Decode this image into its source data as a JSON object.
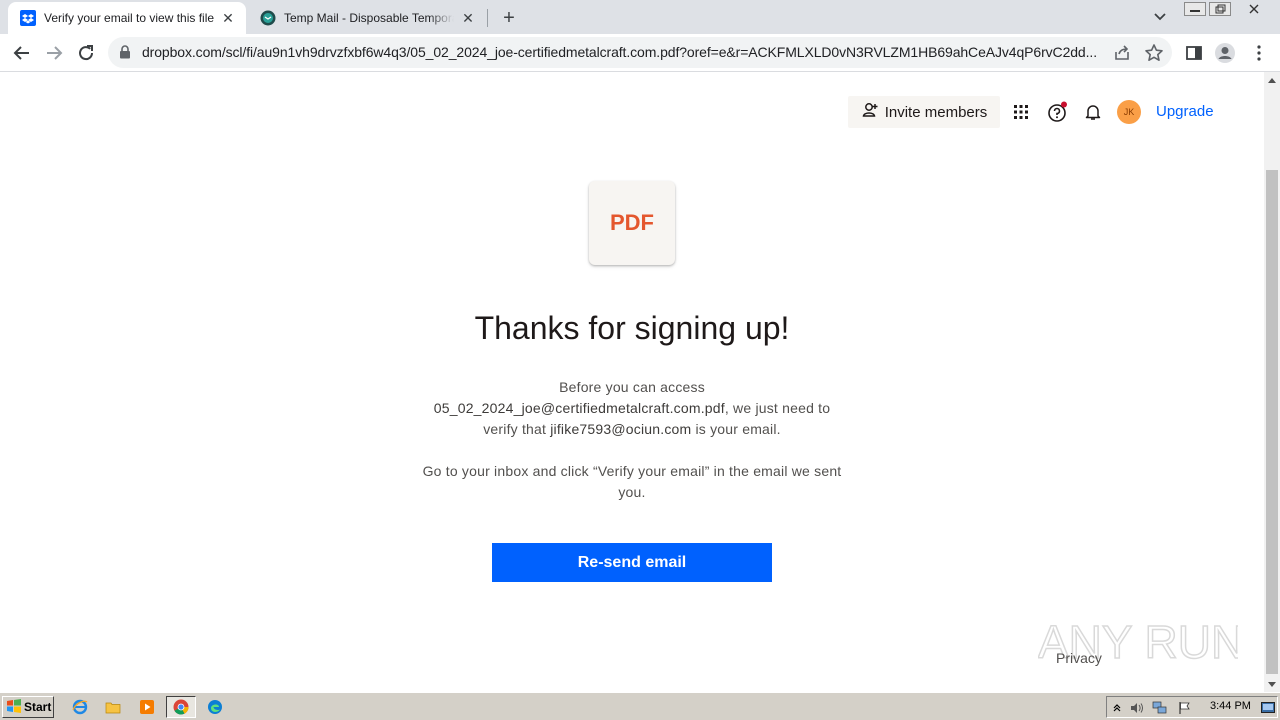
{
  "browser": {
    "tabs": [
      {
        "title": "Verify your email to view this file",
        "favicon": "dropbox-icon",
        "active": true
      },
      {
        "title": "Temp Mail - Disposable Temporary Email",
        "favicon": "tempmail-icon",
        "active": false
      }
    ],
    "url": "dropbox.com/scl/fi/au9n1vh9drvzfxbf6w4q3/05_02_2024_joe-certifiedmetalcraft.com.pdf?oref=e&r=ACKFMLXLD0vN3RVLZM1HB69ahCeAJv4qP6rvC2dd..."
  },
  "header": {
    "invite_label": "Invite members",
    "avatar_initials": "JK",
    "upgrade_label": "Upgrade",
    "help_badge_color": "#c8102e"
  },
  "main": {
    "file_badge": "PDF",
    "heading": "Thanks for signing up!",
    "line1": "Before you can access",
    "filename": "05_02_2024_joe@certifiedmetalcraft.com.pdf",
    "line2_mid": ", we just need to",
    "line3_pre": "verify that ",
    "email": "jifike7593@ociun.com",
    "line3_post": " is your email.",
    "instruction": "Go to your inbox and click “Verify your email” in the email we sent you.",
    "resend_label": "Re-send email",
    "privacy_label": "Privacy",
    "watermark": "ANY RUN"
  },
  "taskbar": {
    "start_label": "Start",
    "clock": "3:44 PM"
  },
  "colors": {
    "accent": "#0061fe",
    "pdf": "#e4572e",
    "avatar": "#fa9f47"
  }
}
